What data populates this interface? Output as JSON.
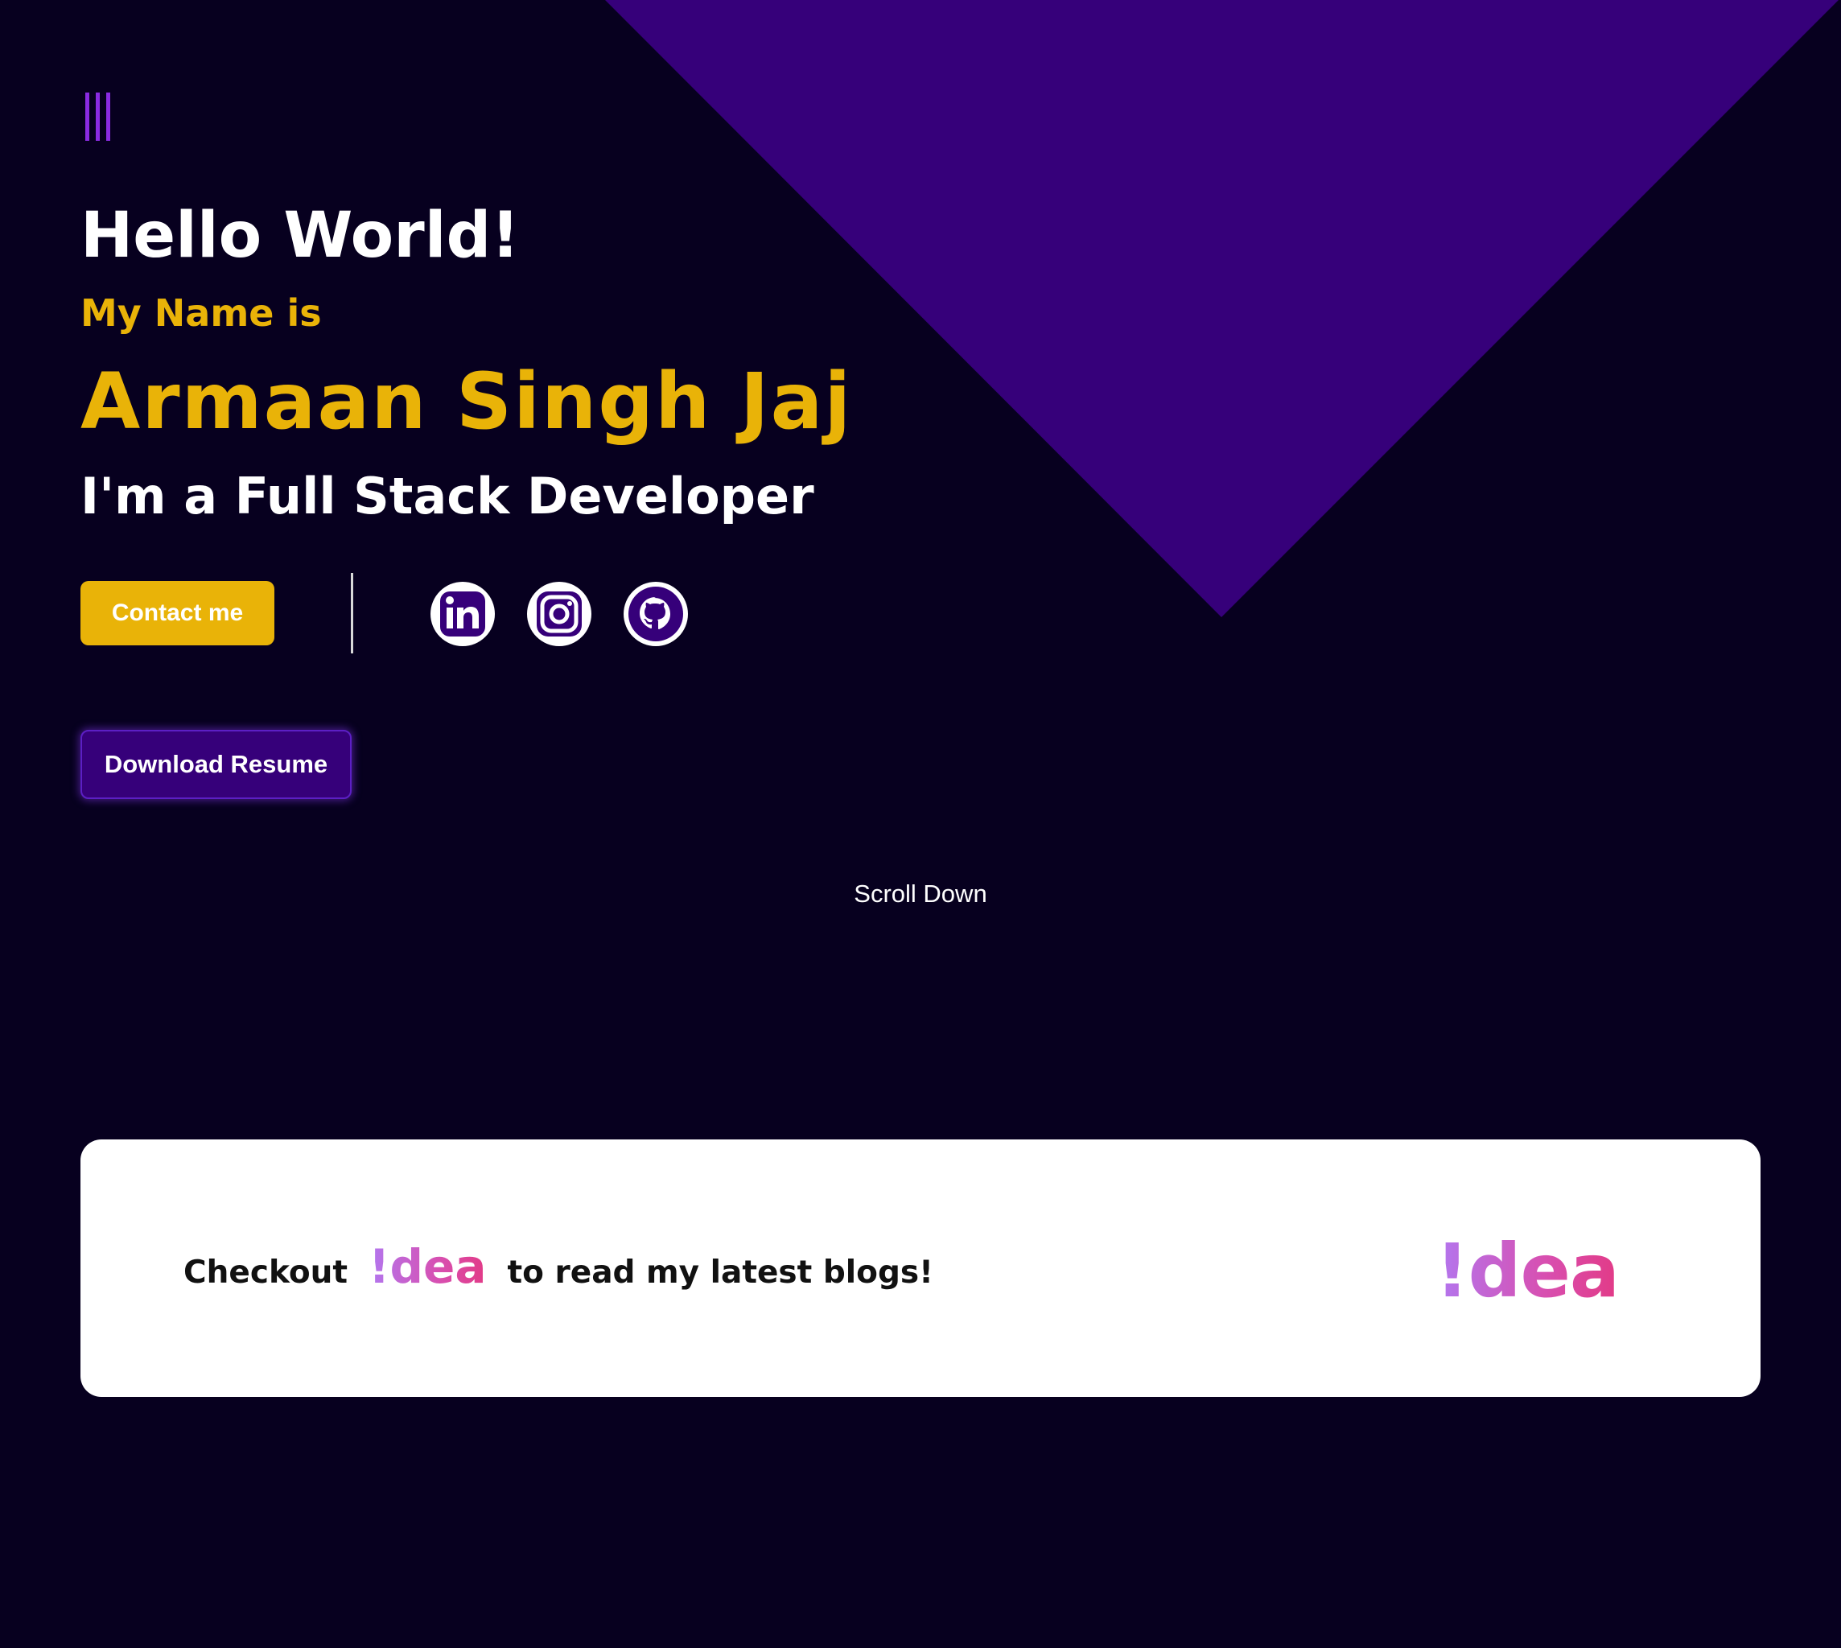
{
  "theme": {
    "background": "#07001f",
    "triangle": "#36007a",
    "accent_yellow": "#e9b308",
    "accent_purple": "#8a2be2",
    "idea_gradient": [
      "#b277f0",
      "#d84fb0",
      "#e23a86"
    ]
  },
  "nav": {
    "menu_icon": "hamburger-icon"
  },
  "hero": {
    "greeting": "Hello World!",
    "intro": "My Name is",
    "name": "Armaan Singh Jaj",
    "role": "I'm a Full Stack Developer",
    "contact_label": "Contact me",
    "resume_label": "Download Resume",
    "socials": [
      {
        "icon": "linkedin-icon"
      },
      {
        "icon": "instagram-icon"
      },
      {
        "icon": "github-icon"
      }
    ]
  },
  "scroll": {
    "label": "Scroll Down"
  },
  "blog_banner": {
    "prefix": "Checkout",
    "brand": "!dea",
    "suffix": "to read my latest blogs!",
    "logo": "!dea"
  }
}
